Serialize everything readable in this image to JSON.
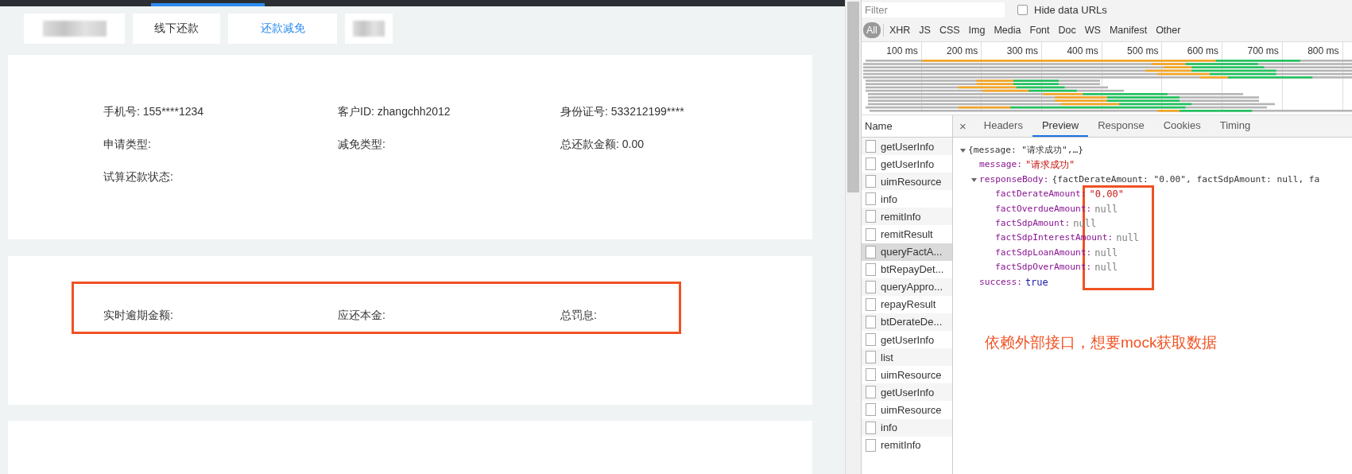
{
  "page_tabs": [
    {
      "kind": "redacted",
      "selected": false
    },
    {
      "kind": "text",
      "label": "线下还款",
      "selected": false
    },
    {
      "kind": "text",
      "label": "还款减免",
      "selected": true
    },
    {
      "kind": "redacted",
      "selected": false
    }
  ],
  "info_card": {
    "fields": [
      {
        "text": "手机号: 155****1234"
      },
      {
        "text": "客户ID: zhangchh2012"
      },
      {
        "text": "身份证号: 533212199****"
      },
      {
        "text": "申请类型:"
      },
      {
        "text": "减免类型:"
      },
      {
        "text": "总还款金额: 0.00"
      },
      {
        "text": "试算还款状态:"
      }
    ]
  },
  "overdue_card": {
    "fields": [
      {
        "text": "实时逾期金额:"
      },
      {
        "text": "应还本金:"
      },
      {
        "text": "总罚息:"
      }
    ]
  },
  "devtools": {
    "filter": {
      "placeholder": "Filter"
    },
    "hide_data_urls": {
      "label": "Hide data URLs",
      "checked": false
    },
    "type_filters": [
      {
        "label": "All",
        "selected": true
      },
      {
        "label": "XHR",
        "selected": false
      },
      {
        "label": "JS",
        "selected": false
      },
      {
        "label": "CSS",
        "selected": false
      },
      {
        "label": "Img",
        "selected": false
      },
      {
        "label": "Media",
        "selected": false
      },
      {
        "label": "Font",
        "selected": false
      },
      {
        "label": "Doc",
        "selected": false
      },
      {
        "label": "WS",
        "selected": false
      },
      {
        "label": "Manifest",
        "selected": false
      },
      {
        "label": "Other",
        "selected": false
      }
    ],
    "timeline_ticks": [
      "100 ms",
      "200 ms",
      "300 ms",
      "400 ms",
      "500 ms",
      "600 ms",
      "700 ms",
      "800 ms"
    ],
    "name_header": "Name",
    "requests": [
      {
        "name": "getUserInfo",
        "selected": false
      },
      {
        "name": "getUserInfo",
        "selected": false
      },
      {
        "name": "uimResource",
        "selected": false
      },
      {
        "name": "info",
        "selected": false
      },
      {
        "name": "remitInfo",
        "selected": false
      },
      {
        "name": "remitResult",
        "selected": false
      },
      {
        "name": "queryFactA...",
        "selected": true
      },
      {
        "name": "btRepayDet...",
        "selected": false
      },
      {
        "name": "queryAppro...",
        "selected": false
      },
      {
        "name": "repayResult",
        "selected": false
      },
      {
        "name": "btDerateDe...",
        "selected": false
      },
      {
        "name": "getUserInfo",
        "selected": false
      },
      {
        "name": "list",
        "selected": false
      },
      {
        "name": "uimResource",
        "selected": false
      },
      {
        "name": "getUserInfo",
        "selected": false
      },
      {
        "name": "uimResource",
        "selected": false
      },
      {
        "name": "info",
        "selected": false
      },
      {
        "name": "remitInfo",
        "selected": false
      }
    ],
    "close": "×",
    "detail_tabs": [
      {
        "label": "Headers",
        "selected": false
      },
      {
        "label": "Preview",
        "selected": true
      },
      {
        "label": "Response",
        "selected": false
      },
      {
        "label": "Cookies",
        "selected": false
      },
      {
        "label": "Timing",
        "selected": false
      }
    ],
    "preview": {
      "summary": "{message: \"请求成功\",…}",
      "expanded": true,
      "children": [
        {
          "key": "message:",
          "value": "\"请求成功\"",
          "color": "#c41a16"
        },
        {
          "key": "responseBody:",
          "summary": "{factDerateAmount: \"0.00\", factSdpAmount: null, fa",
          "expanded": true,
          "children": [
            {
              "key": "factDerateAmount:",
              "value": "\"0.00\"",
              "color": "#c41a16"
            },
            {
              "key": "factOverdueAmount:",
              "value": "null",
              "color": "#808080"
            },
            {
              "key": "factSdpAmount:",
              "value": "null",
              "color": "#808080"
            },
            {
              "key": "factSdpInterestAmount:",
              "value": "null",
              "color": "#808080"
            },
            {
              "key": "factSdpLoanAmount:",
              "value": "null",
              "color": "#808080"
            },
            {
              "key": "factSdpOverAmount:",
              "value": "null",
              "color": "#808080"
            }
          ]
        },
        {
          "key": "success:",
          "value": "true",
          "color": "#1a1aa6"
        }
      ]
    },
    "note": "依赖外部接口，想要mock获取数据"
  }
}
